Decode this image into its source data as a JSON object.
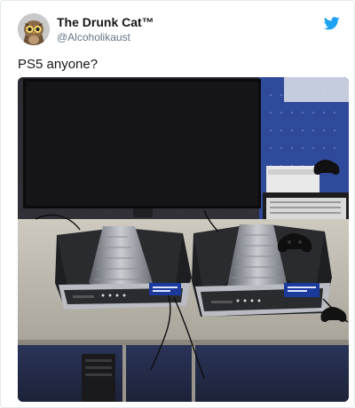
{
  "tweet": {
    "author": {
      "display_name": "The Drunk Cat™",
      "handle": "@Alcoholikaust",
      "avatar_icon": "owl-avatar-icon"
    },
    "platform_icon": "twitter-bird-icon",
    "text": "PS5 anyone?",
    "media": {
      "alt": "Two V-shaped development kit consoles on a table in an office",
      "console_screen_text": "PROSPERO"
    }
  },
  "colors": {
    "accent": "#1da1f2",
    "name": "#14171a",
    "handle": "#657786",
    "border": "#e1e8ed"
  }
}
